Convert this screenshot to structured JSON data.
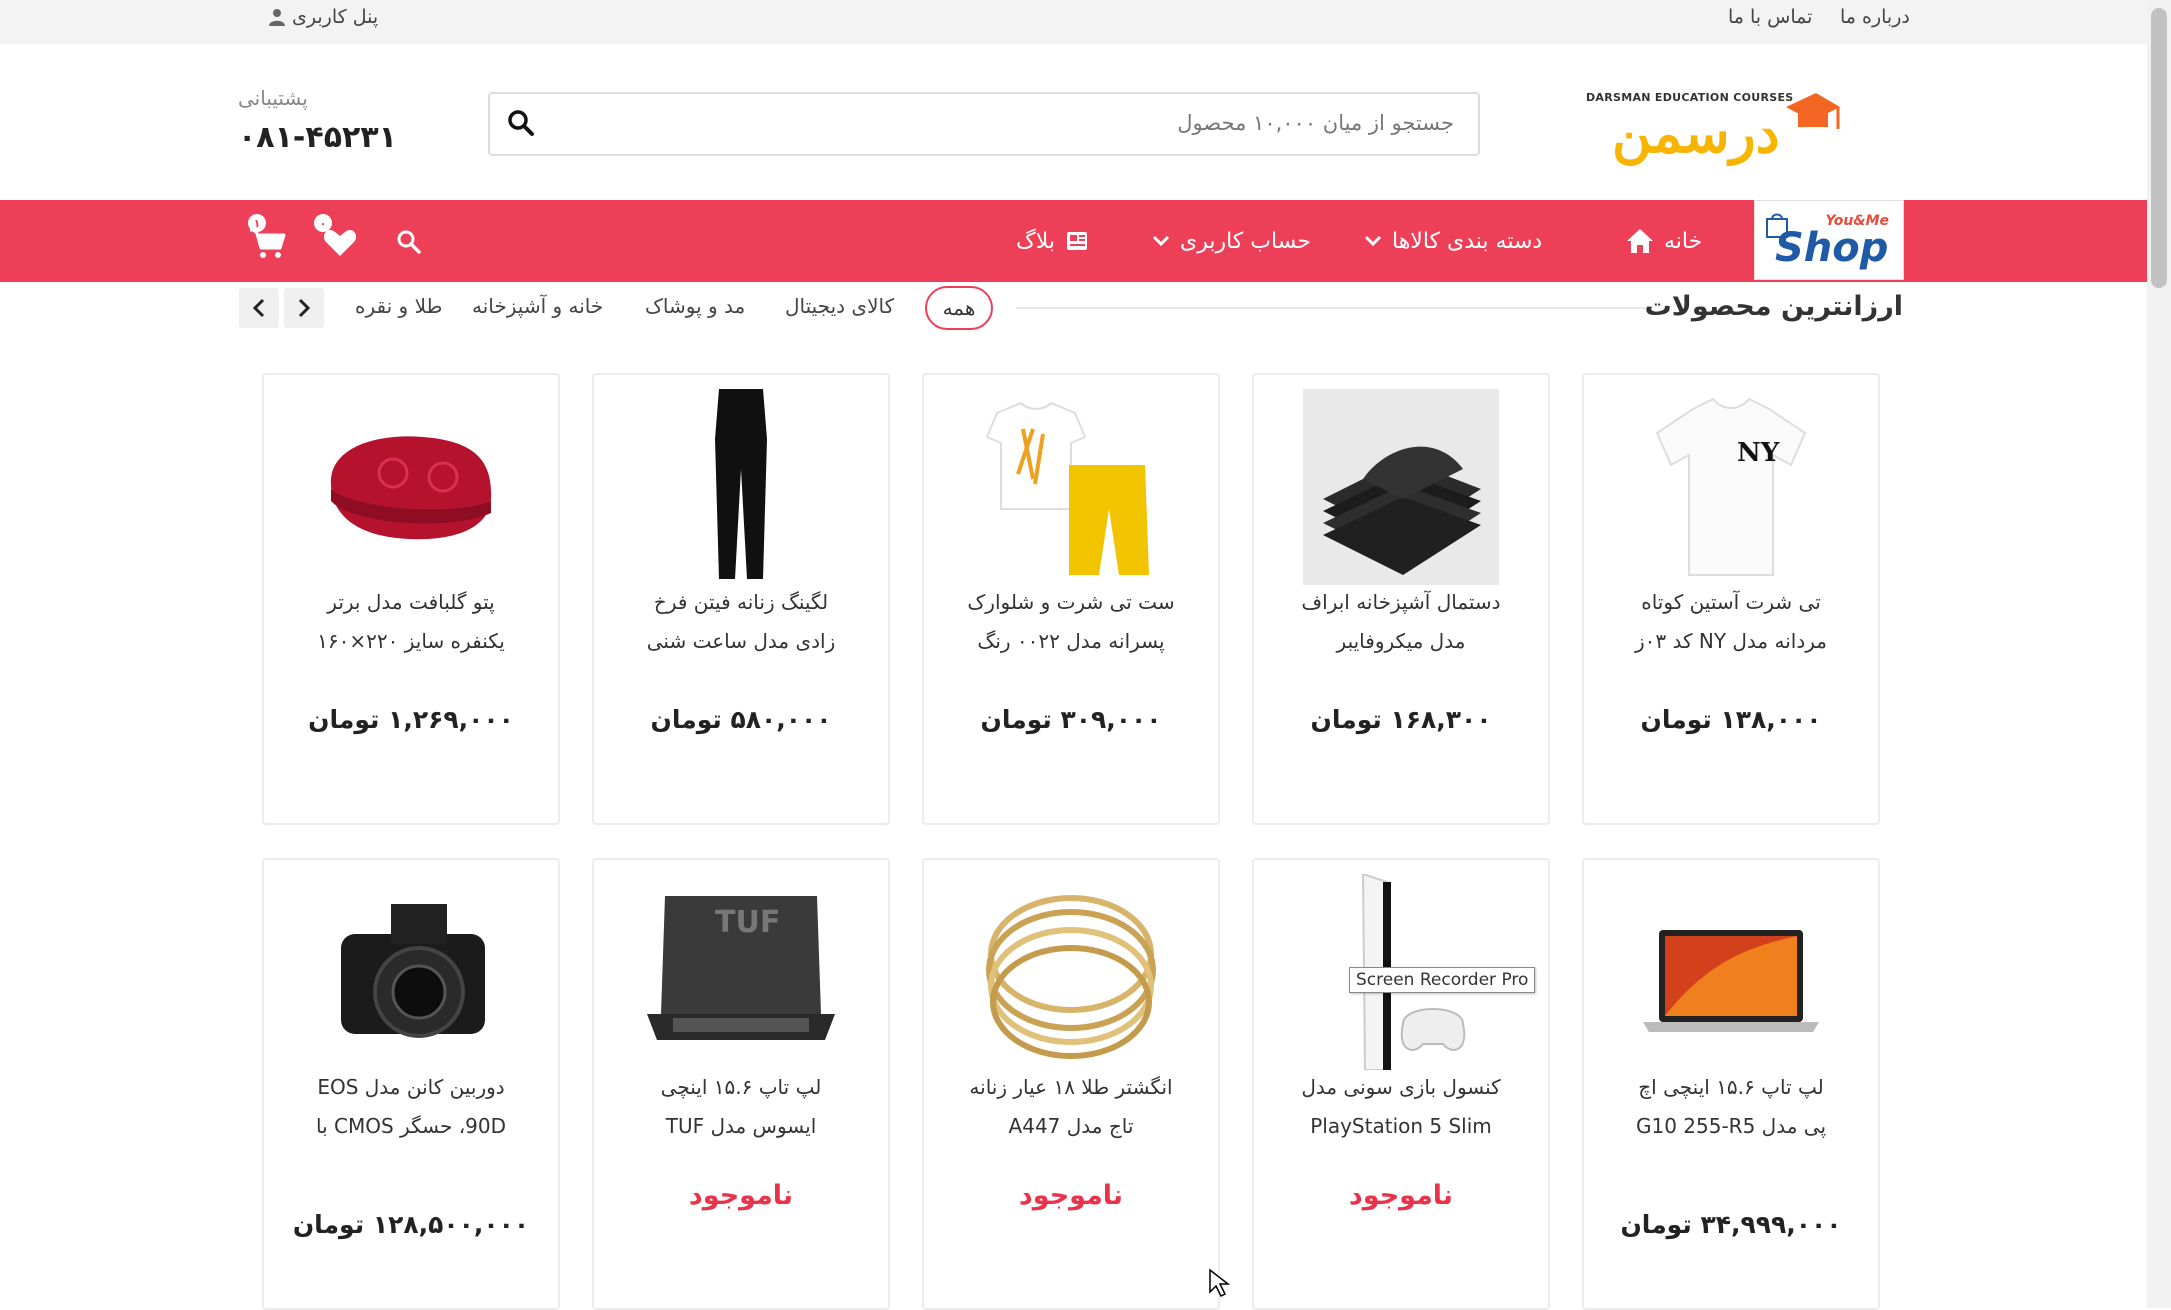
{
  "topbar": {
    "about": "درباره ما",
    "contact": "تماس با ما",
    "user_panel": "پنل کاربری"
  },
  "header": {
    "logo_tagline": "DARSMAN EDUCATION COURSES",
    "logo_text": "درسمن",
    "search_placeholder": "جستجو از میان ۱۰,۰۰۰ محصول",
    "support_label": "پشتیبانی",
    "support_phone": "۰۸۱-۴۵۲۳۱"
  },
  "nav": {
    "shop_logo_top": "You&Me",
    "shop_logo": "Shop",
    "home": "خانه",
    "categories": "دسته بندی کالاها",
    "account": "حساب کاربری",
    "blog": "بلاگ",
    "wishlist_count": "۰",
    "cart_count": "۱",
    "accent_color": "#ed4058"
  },
  "section": {
    "title": "ارزانترین محصولات",
    "tabs": [
      "همه",
      "کالای دیجیتال",
      "مد و پوشاک",
      "خانه و آشپزخانه",
      "طلا و نقره"
    ]
  },
  "products": [
    {
      "line1": "تی شرت آستین کوتاه",
      "line2": "مردانه مدل NY کد ۰۳ز",
      "price": "۱۳۸,۰۰۰ تومان",
      "icon": "tshirt-image"
    },
    {
      "line1": "دستمال آشپزخانه ابراف",
      "line2": "مدل میکروفایبر",
      "price": "۱۶۸,۳۰۰ تومان",
      "icon": "towel-image"
    },
    {
      "line1": "ست تی شرت و شلوارک",
      "line2": "پسرانه مدل ۰۰۲۲ رنگ",
      "price": "۳۰۹,۰۰۰ تومان",
      "icon": "kids-set-image"
    },
    {
      "line1": "لگینگ زنانه فیتن فرخ",
      "line2": "زادی مدل ساعت شنی",
      "price": "۵۸۰,۰۰۰ تومان",
      "icon": "leggings-image"
    },
    {
      "line1": "پتو گلبافت مدل برتر",
      "line2": "یکنفره سایز ۲۲۰×۱۶۰",
      "price": "۱,۲۶۹,۰۰۰ تومان",
      "icon": "blanket-image"
    },
    {
      "line1": "لپ تاپ ۱۵.۶ اینچی اچ",
      "line2": "پی مدل G10 255-R5",
      "price": "۳۴,۹۹۹,۰۰۰ تومان",
      "icon": "laptop-image"
    },
    {
      "line1": "کنسول بازی سونی مدل",
      "line2": "PlayStation 5 Slim",
      "price": "ناموجود",
      "icon": "console-image"
    },
    {
      "line1": "انگشتر طلا ۱۸ عیار زنانه",
      "line2": "تاج مدل A447",
      "price": "ناموجود",
      "icon": "ring-image"
    },
    {
      "line1": "لپ تاپ ۱۵.۶ اینچی",
      "line2": "ایسوس مدل TUF",
      "price": "ناموجود",
      "icon": "tuf-laptop-image"
    },
    {
      "line1": "دوربین کانن مدل EOS",
      "line2": "90D، حسگر CMOS با",
      "price": "۱۲۸,۵۰۰,۰۰۰ تومان",
      "icon": "camera-image"
    }
  ],
  "tooltip": "Screen Recorder Pro"
}
